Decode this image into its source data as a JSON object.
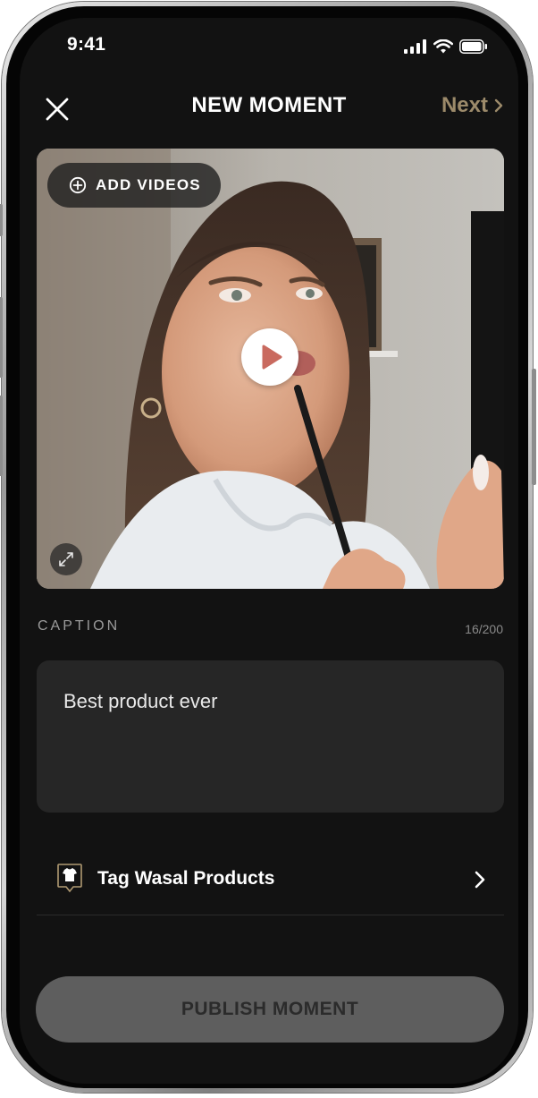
{
  "status_bar": {
    "time": "9:41",
    "icons": [
      "cellular-signal-icon",
      "wifi-icon",
      "battery-icon"
    ]
  },
  "header": {
    "title": "NEW MOMENT",
    "next_label": "Next",
    "close_icon": "close-icon",
    "next_icon": "chevron-right-icon"
  },
  "video": {
    "add_videos_label": "ADD VIDEOS",
    "add_icon": "plus-circle-icon",
    "play_icon": "play-icon",
    "expand_icon": "expand-icon"
  },
  "caption": {
    "label": "CAPTION",
    "count": "16/200",
    "value": "Best product ever"
  },
  "tag_products": {
    "label": "Tag Wasal Products",
    "icon": "tshirt-tag-icon",
    "chevron_icon": "chevron-right-icon"
  },
  "publish": {
    "label": "PUBLISH MOMENT"
  },
  "colors": {
    "background": "#121212",
    "accent_next": "#9c8a6a",
    "caption_box": "#262626",
    "publish_button": "#5e5e5e",
    "publish_text": "#2b2b2b"
  }
}
